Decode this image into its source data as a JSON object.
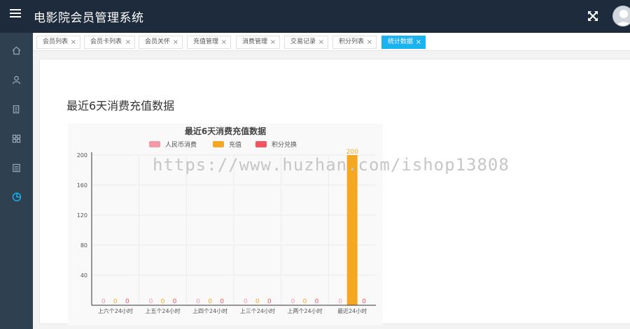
{
  "app": {
    "title": "电影院会员管理系统"
  },
  "tabs": [
    {
      "label": "会员列表",
      "active": false
    },
    {
      "label": "会员卡列表",
      "active": false
    },
    {
      "label": "会员关怀",
      "active": false
    },
    {
      "label": "充值管理",
      "active": false
    },
    {
      "label": "消费管理",
      "active": false
    },
    {
      "label": "交易记录",
      "active": false
    },
    {
      "label": "积分列表",
      "active": false
    },
    {
      "label": "统计数据",
      "active": true
    }
  ],
  "sidebar": {
    "items": [
      {
        "icon": "home-icon"
      },
      {
        "icon": "user-icon"
      },
      {
        "icon": "document-icon"
      },
      {
        "icon": "grid-icon"
      },
      {
        "icon": "list-icon"
      },
      {
        "icon": "pie-chart-icon",
        "active": true
      }
    ]
  },
  "main": {
    "section_title": "最近6天消费充值数据"
  },
  "watermark": "https://www.huzhan.com/ishop13808",
  "colors": {
    "topbar": "#1e2b3c",
    "sidebar": "#2f4050",
    "active_tab": "#1ab3f0",
    "series_rmb": "#f49aa6",
    "series_recharge": "#f5a623",
    "series_points": "#f0545e"
  },
  "chart_data": {
    "type": "bar",
    "title": "最近6天消费充值数据",
    "categories": [
      "上六个24小时",
      "上五个24小时",
      "上四个24小时",
      "上三个24小时",
      "上两个24小时",
      "最近24小时"
    ],
    "series": [
      {
        "name": "人民币消费",
        "color": "#f49aa6",
        "values": [
          0,
          0,
          0,
          0,
          0,
          0
        ]
      },
      {
        "name": "充值",
        "color": "#f5a623",
        "values": [
          0,
          0,
          0,
          0,
          0,
          200
        ]
      },
      {
        "name": "积分兑换",
        "color": "#f0545e",
        "values": [
          0,
          0,
          0,
          0,
          0,
          0
        ]
      }
    ],
    "yticks": [
      40,
      80,
      120,
      160,
      200
    ],
    "ylim": [
      0,
      200
    ],
    "legend": "top",
    "grid": true
  }
}
